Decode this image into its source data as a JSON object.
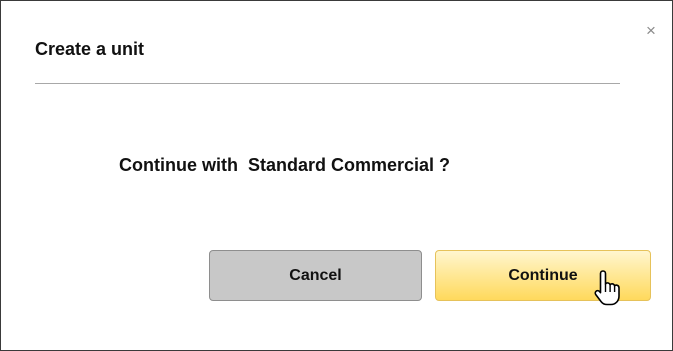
{
  "dialog": {
    "title": "Create a unit",
    "close_glyph": "×",
    "message": "Continue with  Standard Commercial ?",
    "cancel_label": "Cancel",
    "continue_label": "Continue",
    "close_icon": "close-icon",
    "cursor_icon": "hand-pointer-cursor-icon"
  },
  "colors": {
    "cancel_button": "#c8c8c8",
    "continue_button": "#ffd95c",
    "border": "#3a3a3a"
  }
}
